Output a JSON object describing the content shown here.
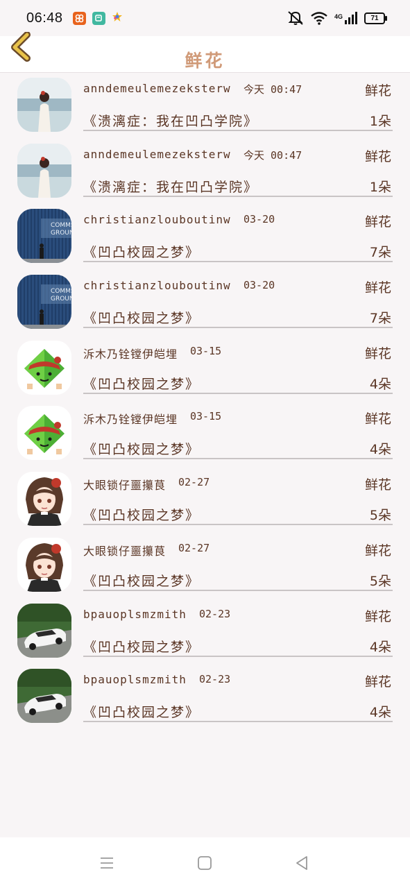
{
  "status_bar": {
    "time": "06:48",
    "battery": "71",
    "network": "4G"
  },
  "header": {
    "title": "鲜花"
  },
  "rows": [
    {
      "user": "anndemeulemezeksterw",
      "date": "今天 00:47",
      "label": "鲜花",
      "book": "《溃漓症：我在凹凸学院》",
      "count": "1朵",
      "avatar": "girl-beach"
    },
    {
      "user": "anndemeulemezeksterw",
      "date": "今天 00:47",
      "label": "鲜花",
      "book": "《溃漓症：我在凹凸学院》",
      "count": "1朵",
      "avatar": "girl-beach"
    },
    {
      "user": "christianzlouboutinw",
      "date": "03-20",
      "label": "鲜花",
      "book": "《凹凸校园之梦》",
      "count": "7朵",
      "avatar": "container-wall"
    },
    {
      "user": "christianzlouboutinw",
      "date": "03-20",
      "label": "鲜花",
      "book": "《凹凸校园之梦》",
      "count": "7朵",
      "avatar": "container-wall"
    },
    {
      "user": "泝木乃铨镗伊皑埋",
      "date": "03-15",
      "label": "鲜花",
      "book": "《凹凸校园之梦》",
      "count": "4朵",
      "avatar": "zongzi"
    },
    {
      "user": "泝木乃铨镗伊皑埋",
      "date": "03-15",
      "label": "鲜花",
      "book": "《凹凸校园之梦》",
      "count": "4朵",
      "avatar": "zongzi"
    },
    {
      "user": "大眼锁仔噩攥茛",
      "date": "02-27",
      "label": "鲜花",
      "book": "《凹凸校园之梦》",
      "count": "5朵",
      "avatar": "anime-girl"
    },
    {
      "user": "大眼锁仔噩攥茛",
      "date": "02-27",
      "label": "鲜花",
      "book": "《凹凸校园之梦》",
      "count": "5朵",
      "avatar": "anime-girl"
    },
    {
      "user": "bpauoplsmzmith",
      "date": "02-23",
      "label": "鲜花",
      "book": "《凹凸校园之梦》",
      "count": "4朵",
      "avatar": "white-car"
    },
    {
      "user": "bpauoplsmzmith",
      "date": "02-23",
      "label": "鲜花",
      "book": "《凹凸校园之梦》",
      "count": "4朵",
      "avatar": "white-car"
    }
  ],
  "icons": {
    "back": "chevron-left-icon",
    "nav_menu": "menu-icon",
    "nav_home": "home-square-icon",
    "nav_back": "back-triangle-icon"
  },
  "colors": {
    "accent_back": "#e8c24a",
    "title": "#d09a78",
    "text": "#5a3524"
  }
}
